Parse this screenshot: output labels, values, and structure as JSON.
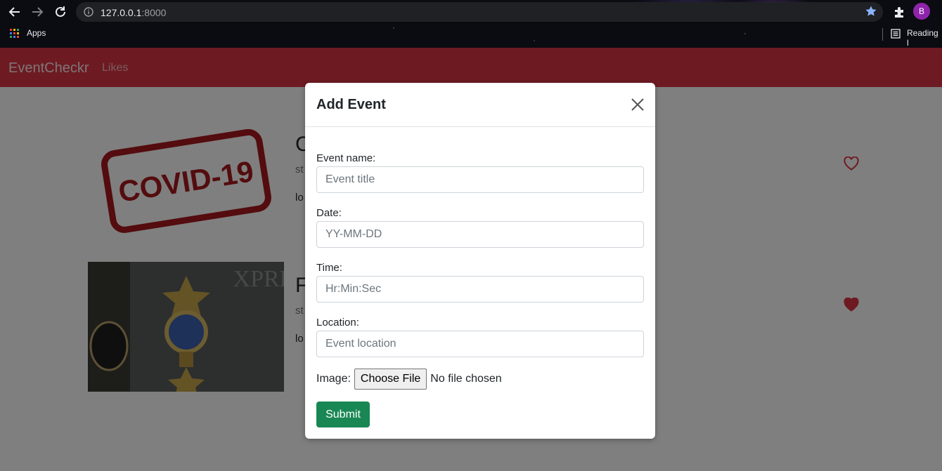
{
  "browser": {
    "url_host": "127.0.0.1",
    "url_port": ":8000",
    "bookmarks": {
      "apps": "Apps",
      "reading_list": "Reading l"
    },
    "profile_initial": "B"
  },
  "navbar": {
    "brand": "EventCheckr",
    "likes": "Likes"
  },
  "events": [
    {
      "title_initial": "C",
      "sub": "st",
      "loc": "lo",
      "image_text": "COVID-19",
      "liked": false
    },
    {
      "title_initial": "F",
      "sub": "st",
      "loc": "lo",
      "image_text": "XPRE",
      "liked": true
    }
  ],
  "modal": {
    "title": "Add Event",
    "fields": {
      "name": {
        "label": "Event name:",
        "placeholder": "Event title"
      },
      "date": {
        "label": "Date:",
        "placeholder": "YY-MM-DD"
      },
      "time": {
        "label": "Time:",
        "placeholder": "Hr:Min:Sec"
      },
      "location": {
        "label": "Location:",
        "placeholder": "Event location"
      }
    },
    "image": {
      "label": "Image:",
      "button": "Choose File",
      "status": "No file chosen"
    },
    "submit": "Submit"
  },
  "colors": {
    "navbar": "#dc3545",
    "submit": "#198754",
    "heart": "#dc3545"
  }
}
